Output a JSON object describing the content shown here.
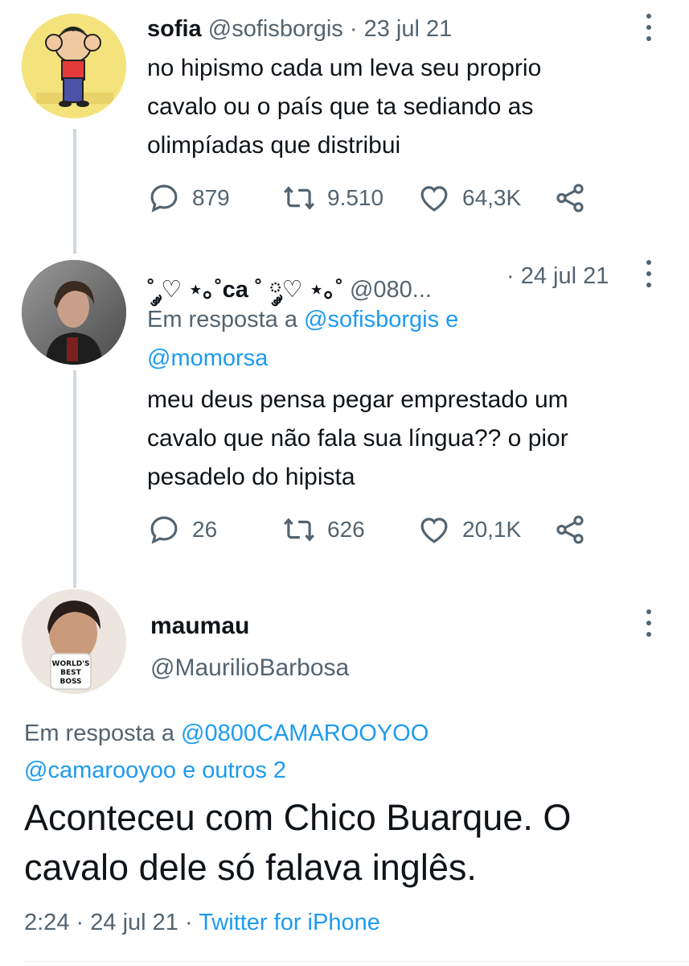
{
  "tweets": [
    {
      "name": "sofia",
      "handle": "@sofisborgis",
      "dot": "·",
      "date": "23 jul 21",
      "lines": [
        "no hipismo cada um leva seu proprio",
        "cavalo ou o país que ta sediando as",
        "olimpíadas que distribui"
      ],
      "replies": "879",
      "retweets": "9.510",
      "likes": "64,3K"
    },
    {
      "name": "˚ ༘♡ ⋆｡˚ca ˚ ༘♡ ⋆｡˚",
      "handle": "@080...",
      "dot": "·",
      "date": "24 jul 21",
      "reply_prefix": "Em resposta a",
      "reply_to_1": "@sofisborgis",
      "reply_joiner": "e",
      "reply_to_2": "@momorsa",
      "lines": [
        "meu deus pensa pegar emprestado um",
        "cavalo que não fala sua língua?? o pior",
        "pesadelo do hipista"
      ],
      "replies": "26",
      "retweets": "626",
      "likes": "20,1K"
    }
  ],
  "main": {
    "name": "maumau",
    "handle": "@MaurilioBarbosa",
    "mug_text": [
      "WORLD'S",
      "BEST",
      "BOSS"
    ],
    "reply_prefix": "Em resposta a",
    "reply_to_1": "@0800CAMAROOYOO",
    "reply_to_2": "@camarooyoo",
    "reply_suffix": "e outros 2",
    "lines": [
      "Aconteceu com Chico Buarque. O",
      "cavalo dele só falava inglês."
    ],
    "time": "2:24",
    "dot": "·",
    "date": "24 jul 21",
    "dot2": "·",
    "source": "Twitter for iPhone"
  },
  "colors": {
    "accent": "#1d9bf0",
    "muted": "#536471",
    "thread_line": "#cfd9de"
  },
  "icons": [
    "reply-icon",
    "retweet-icon",
    "like-icon",
    "share-icon",
    "more-icon"
  ]
}
